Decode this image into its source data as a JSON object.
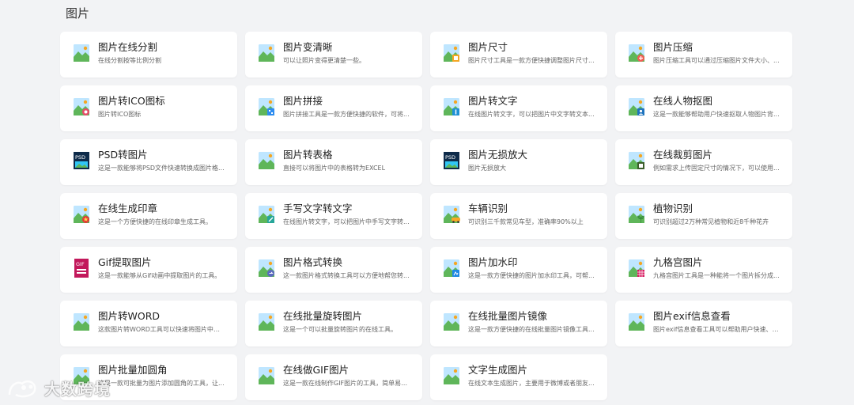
{
  "section": {
    "title": "图片"
  },
  "tools": [
    {
      "name": "图片在线分割",
      "desc": "在线分割按等比例分割",
      "icon": "picture-icon"
    },
    {
      "name": "图片变清晰",
      "desc": "可以让照片变得更清楚一些。",
      "icon": "picture-icon"
    },
    {
      "name": "图片尺寸",
      "desc": "图片尺寸工具是一款方便快捷调整图片尺寸...",
      "icon": "picture-resize-icon"
    },
    {
      "name": "图片压缩",
      "desc": "图片压缩工具可以通过压缩图片文件大小、...",
      "icon": "picture-compress-icon"
    },
    {
      "name": "图片转ICO图标",
      "desc": "图片转ICO图标",
      "icon": "picture-ico-icon"
    },
    {
      "name": "图片拼接",
      "desc": "图片拼接工具是一款方便快捷的软件，可将...",
      "icon": "picture-stitch-icon"
    },
    {
      "name": "图片转文字",
      "desc": "在线图片转文字，可以把图片中文字转文本...",
      "icon": "picture-ocr-icon"
    },
    {
      "name": "在线人物抠图",
      "desc": "这是一款能够帮助用户快速抠取人物图片背...",
      "icon": "picture-cutout-icon"
    },
    {
      "name": "PSD转图片",
      "desc": "这是一款能够将PSD文件快速转换成图片格...",
      "icon": "psd-icon"
    },
    {
      "name": "图片转表格",
      "desc": "直接可以将图片中的表格转为EXCEL",
      "icon": "picture-icon"
    },
    {
      "name": "图片无损放大",
      "desc": "图片无损放大",
      "icon": "psd-icon"
    },
    {
      "name": "在线裁剪图片",
      "desc": "例如需求上传固定尺寸的情况下，可以使用...",
      "icon": "picture-crop-icon"
    },
    {
      "name": "在线生成印章",
      "desc": "这是一个方便快捷的在线印章生成工具。",
      "icon": "picture-seal-icon"
    },
    {
      "name": "手写文字转文字",
      "desc": "在线图片转文字，可以把图片中手写文字转...",
      "icon": "picture-handwriting-icon"
    },
    {
      "name": "车辆识别",
      "desc": "可识别三千款常见车型，准确率90%以上",
      "icon": "picture-car-icon"
    },
    {
      "name": "植物识别",
      "desc": "可识别超过2万种常见植物和近8千种花卉",
      "icon": "picture-plant-icon"
    },
    {
      "name": "Gif提取图片",
      "desc": "这是一款能够从Gif动画中提取图片的工具。",
      "icon": "gif-icon"
    },
    {
      "name": "图片格式转换",
      "desc": "这一款图片格式转换工具可以方便地帮您转...",
      "icon": "picture-convert-icon"
    },
    {
      "name": "图片加水印",
      "desc": "这是一款方便快捷的图片加水印工具，可帮...",
      "icon": "picture-watermark-icon"
    },
    {
      "name": "九格宫图片",
      "desc": "九格宫图片工具是一种能将一个图片拆分成...",
      "icon": "picture-grid-icon"
    },
    {
      "name": "图片转WORD",
      "desc": "这款图片转WORD工具可以快速将图片中的...",
      "icon": "picture-icon"
    },
    {
      "name": "在线批量旋转图片",
      "desc": "这是一个可以批量旋转图片的在线工具。",
      "icon": "picture-icon"
    },
    {
      "name": "在线批量图片镜像",
      "desc": "这是一款方便快捷的在线批量图片镜像工具...",
      "icon": "picture-icon"
    },
    {
      "name": "图片exif信息查看",
      "desc": "图片exif信息查看工具可以帮助用户快速、方...",
      "icon": "picture-icon"
    },
    {
      "name": "图片批量加圆角",
      "desc": "这是一款可批量为图片添加圆角的工具，让...",
      "icon": "picture-icon"
    },
    {
      "name": "在线做GIF图片",
      "desc": "这是一款在线制作GIF图片的工具，简单易用...",
      "icon": "picture-icon"
    },
    {
      "name": "文字生成图片",
      "desc": "在线文本生成图片，主要用于微博或者朋友...",
      "icon": "picture-icon"
    }
  ],
  "watermark": {
    "text": "大数跨境"
  },
  "colors": {
    "sky": "#bfe6ff",
    "mountain": "#5fb65a",
    "sun": "#f5a623",
    "page_bg": "#f2f3f5"
  }
}
